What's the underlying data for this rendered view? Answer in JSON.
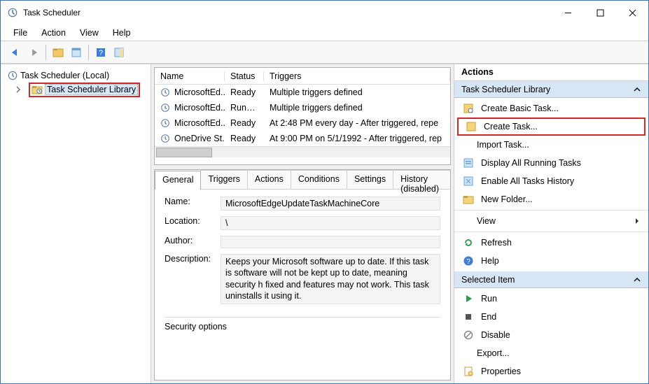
{
  "window": {
    "title": "Task Scheduler"
  },
  "menubar": {
    "file": "File",
    "action": "Action",
    "view": "View",
    "help": "Help"
  },
  "tree": {
    "root": "Task Scheduler (Local)",
    "library": "Task Scheduler Library"
  },
  "task_columns": {
    "name": "Name",
    "status": "Status",
    "triggers": "Triggers"
  },
  "tasks": [
    {
      "name": "MicrosoftEd...",
      "status": "Ready",
      "triggers": "Multiple triggers defined"
    },
    {
      "name": "MicrosoftEd...",
      "status": "Running",
      "triggers": "Multiple triggers defined"
    },
    {
      "name": "MicrosoftEd...",
      "status": "Ready",
      "triggers": "At 2:48 PM every day - After triggered, repe"
    },
    {
      "name": "OneDrive St...",
      "status": "Ready",
      "triggers": "At 9:00 PM on 5/1/1992 - After triggered, rep"
    }
  ],
  "detail_tabs": {
    "general": "General",
    "triggers": "Triggers",
    "actions": "Actions",
    "conditions": "Conditions",
    "settings": "Settings",
    "history": "History (disabled)"
  },
  "detail": {
    "name_label": "Name:",
    "name_value": "MicrosoftEdgeUpdateTaskMachineCore",
    "location_label": "Location:",
    "location_value": "\\",
    "author_label": "Author:",
    "author_value": "",
    "description_label": "Description:",
    "description_value": "Keeps your Microsoft software up to date. If this task is software will not be kept up to date, meaning security h fixed and features may not work. This task uninstalls it using it.",
    "security_label": "Security options"
  },
  "actions_panel": {
    "header": "Actions",
    "subheader": "Task Scheduler Library",
    "items": {
      "create_basic": "Create Basic Task...",
      "create_task": "Create Task...",
      "import_task": "Import Task...",
      "display_running": "Display All Running Tasks",
      "enable_history": "Enable All Tasks History",
      "new_folder": "New Folder...",
      "view": "View",
      "refresh": "Refresh",
      "help": "Help"
    },
    "selected_header": "Selected Item",
    "selected_items": {
      "run": "Run",
      "end": "End",
      "disable": "Disable",
      "export": "Export...",
      "properties": "Properties"
    }
  }
}
